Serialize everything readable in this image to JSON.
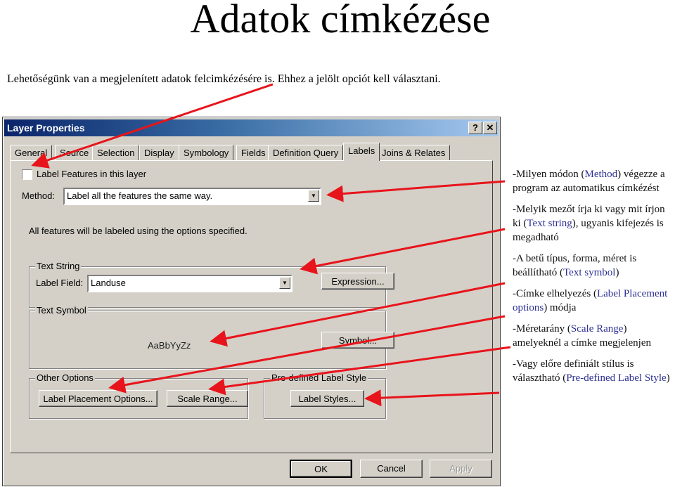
{
  "page": {
    "title": "Adatok címkézése",
    "intro": "Lehetőségünk van a megjelenített adatok felcimkézésére is. Ehhez a jelölt opciót kell választani."
  },
  "dialog": {
    "title": "Layer Properties",
    "help_label": "?",
    "close_label": "✕",
    "tabs": [
      {
        "label": "General"
      },
      {
        "label": "Source"
      },
      {
        "label": "Selection"
      },
      {
        "label": "Display"
      },
      {
        "label": "Symbology"
      },
      {
        "label": "Fields"
      },
      {
        "label": "Definition Query"
      },
      {
        "label": "Labels",
        "active": true
      },
      {
        "label": "Joins & Relates"
      }
    ],
    "label_features_checkbox": {
      "label": "Label Features in this layer",
      "checked": false
    },
    "method": {
      "label": "Method:",
      "value": "Label all the features the same way."
    },
    "info_text": "All features will be labeled using the options specified.",
    "text_string": {
      "legend": "Text String",
      "label_field_label": "Label Field:",
      "label_field_value": "Landuse",
      "expression_button": "Expression..."
    },
    "text_symbol": {
      "legend": "Text Symbol",
      "sample": "AaBbYyZz",
      "symbol_button": "Symbol..."
    },
    "other_options": {
      "legend": "Other Options",
      "placement_button": "Label Placement Options...",
      "scale_button": "Scale Range..."
    },
    "predefined": {
      "legend": "Pre-defined Label Style",
      "styles_button": "Label Styles..."
    },
    "footer": {
      "ok": "OK",
      "cancel": "Cancel",
      "apply": "Apply"
    }
  },
  "notes": [
    {
      "pre": "-Milyen módon (",
      "hl": "Method",
      "post": ") végezze a program az automatikus címkézést"
    },
    {
      "pre": "-Melyik mezőt írja ki vagy mit írjon ki (",
      "hl": "Text string",
      "post": "), ugyanis kifejezés is megadható"
    },
    {
      "pre": "-A betű típus, forma, méret is beállítható (",
      "hl": "Text symbol",
      "post": ")"
    },
    {
      "pre": "-Címke elhelyezés (",
      "hl": "Label Placement options",
      "post": ") módja"
    },
    {
      "pre": "-Méretarány (",
      "hl": "Scale Range",
      "post": ") amelyeknél a címke megjelenjen"
    },
    {
      "pre": "-Vagy előre definiált stílus is választható (",
      "hl": "Pre-defined Label Style",
      "post": ")"
    }
  ],
  "colors": {
    "arrow": "#e8141b",
    "highlight": "#2e3192",
    "dialog_bg": "#d4d0c8"
  }
}
